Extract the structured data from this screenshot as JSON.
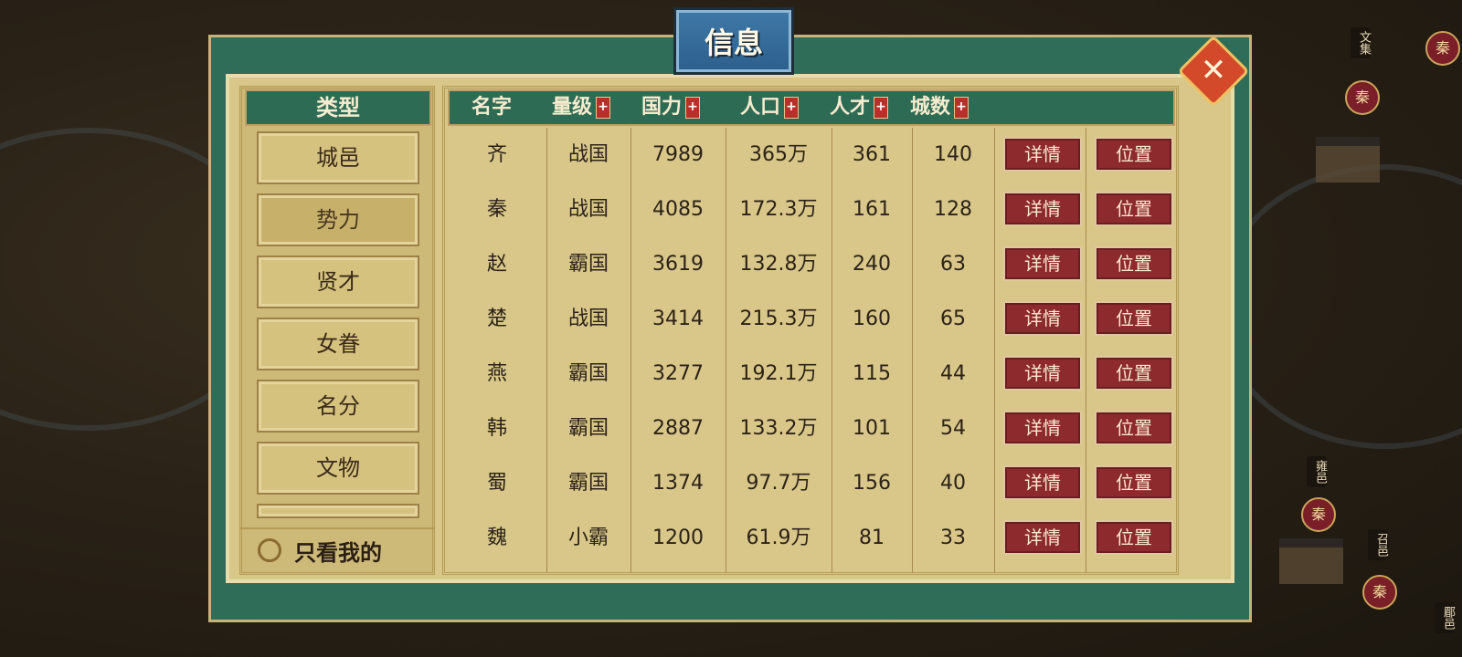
{
  "window": {
    "title": "信息",
    "close_icon": "close-icon"
  },
  "types": {
    "header": "类型",
    "items": [
      {
        "label": "城邑",
        "active": false
      },
      {
        "label": "势力",
        "active": true
      },
      {
        "label": "贤才",
        "active": false
      },
      {
        "label": "女眷",
        "active": false
      },
      {
        "label": "名分",
        "active": false
      },
      {
        "label": "文物",
        "active": false
      }
    ],
    "only_mine": "只看我的"
  },
  "table": {
    "columns": [
      "名字",
      "量级",
      "国力",
      "人口",
      "人才",
      "城数"
    ],
    "rows": [
      {
        "name": "齐",
        "level": "战国",
        "power": "7989",
        "population": "365万",
        "talent": "361",
        "cities": "140",
        "detail": "详情",
        "location": "位置"
      },
      {
        "name": "秦",
        "level": "战国",
        "power": "4085",
        "population": "172.3万",
        "talent": "161",
        "cities": "128",
        "detail": "详情",
        "location": "位置"
      },
      {
        "name": "赵",
        "level": "霸国",
        "power": "3619",
        "population": "132.8万",
        "talent": "240",
        "cities": "63",
        "detail": "详情",
        "location": "位置"
      },
      {
        "name": "楚",
        "level": "战国",
        "power": "3414",
        "population": "215.3万",
        "talent": "160",
        "cities": "65",
        "detail": "详情",
        "location": "位置"
      },
      {
        "name": "燕",
        "level": "霸国",
        "power": "3277",
        "population": "192.1万",
        "talent": "115",
        "cities": "44",
        "detail": "详情",
        "location": "位置"
      },
      {
        "name": "韩",
        "level": "霸国",
        "power": "2887",
        "population": "133.2万",
        "talent": "101",
        "cities": "54",
        "detail": "详情",
        "location": "位置"
      },
      {
        "name": "蜀",
        "level": "霸国",
        "power": "1374",
        "population": "97.7万",
        "talent": "156",
        "cities": "40",
        "detail": "详情",
        "location": "位置"
      },
      {
        "name": "魏",
        "level": "小霸",
        "power": "1200",
        "population": "61.9万",
        "talent": "81",
        "cities": "33",
        "detail": "详情",
        "location": "位置"
      }
    ]
  },
  "map": {
    "tags": [
      "文集",
      "雍邑",
      "召邑",
      "郿邑"
    ],
    "seals": [
      "秦",
      "秦",
      "秦",
      "秦"
    ]
  }
}
